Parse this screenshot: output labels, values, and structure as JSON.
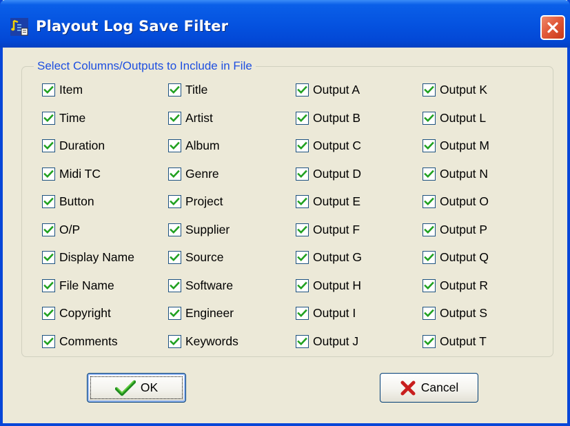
{
  "window": {
    "title": "Playout Log Save Filter",
    "app_icon": "music-note-document-icon",
    "close_icon": "close-icon"
  },
  "group": {
    "legend": "Select Columns/Outputs to Include in File"
  },
  "columns": [
    {
      "items": [
        {
          "label": "Item",
          "checked": true
        },
        {
          "label": "Time",
          "checked": true
        },
        {
          "label": "Duration",
          "checked": true
        },
        {
          "label": "Midi TC",
          "checked": true
        },
        {
          "label": "Button",
          "checked": true
        },
        {
          "label": "O/P",
          "checked": true
        },
        {
          "label": "Display Name",
          "checked": true
        },
        {
          "label": "File Name",
          "checked": true
        },
        {
          "label": "Copyright",
          "checked": true
        },
        {
          "label": "Comments",
          "checked": true
        }
      ]
    },
    {
      "items": [
        {
          "label": "Title",
          "checked": true
        },
        {
          "label": "Artist",
          "checked": true
        },
        {
          "label": "Album",
          "checked": true
        },
        {
          "label": "Genre",
          "checked": true
        },
        {
          "label": "Project",
          "checked": true
        },
        {
          "label": "Supplier",
          "checked": true
        },
        {
          "label": "Source",
          "checked": true
        },
        {
          "label": "Software",
          "checked": true
        },
        {
          "label": "Engineer",
          "checked": true
        },
        {
          "label": "Keywords",
          "checked": true
        }
      ]
    },
    {
      "items": [
        {
          "label": "Output A",
          "checked": true
        },
        {
          "label": "Output B",
          "checked": true
        },
        {
          "label": "Output C",
          "checked": true
        },
        {
          "label": "Output D",
          "checked": true
        },
        {
          "label": "Output E",
          "checked": true
        },
        {
          "label": "Output F",
          "checked": true
        },
        {
          "label": "Output G",
          "checked": true
        },
        {
          "label": "Output H",
          "checked": true
        },
        {
          "label": "Output I",
          "checked": true
        },
        {
          "label": "Output J",
          "checked": true
        }
      ]
    },
    {
      "items": [
        {
          "label": "Output K",
          "checked": true
        },
        {
          "label": "Output L",
          "checked": true
        },
        {
          "label": "Output M",
          "checked": true
        },
        {
          "label": "Output N",
          "checked": true
        },
        {
          "label": "Output O",
          "checked": true
        },
        {
          "label": "Output P",
          "checked": true
        },
        {
          "label": "Output Q",
          "checked": true
        },
        {
          "label": "Output R",
          "checked": true
        },
        {
          "label": "Output S",
          "checked": true
        },
        {
          "label": "Output T",
          "checked": true
        }
      ]
    }
  ],
  "buttons": {
    "ok": {
      "label": "OK",
      "icon": "checkmark-icon"
    },
    "cancel": {
      "label": "Cancel",
      "icon": "red-x-icon"
    }
  },
  "colors": {
    "title_bar": "#0553E0",
    "dialog_bg": "#ECE9D8",
    "legend_text": "#1E4FE0",
    "check_mark": "#21A121",
    "close_button": "#E25A3A"
  }
}
